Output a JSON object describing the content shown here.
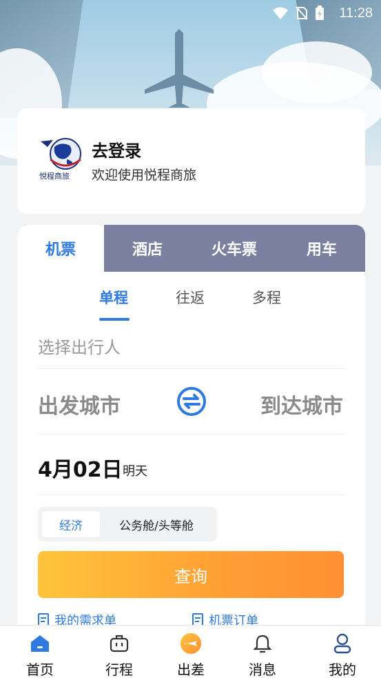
{
  "status_bar": {
    "time": "11:28"
  },
  "login": {
    "title": "去登录",
    "subtitle": "欢迎使用悦程商旅",
    "logo_icon": "globe-logo-icon"
  },
  "service_tabs": [
    {
      "label": "机票",
      "active": true
    },
    {
      "label": "酒店",
      "active": false
    },
    {
      "label": "火车票",
      "active": false
    },
    {
      "label": "用车",
      "active": false
    }
  ],
  "trip_types": [
    {
      "label": "单程",
      "active": true
    },
    {
      "label": "往返",
      "active": false
    },
    {
      "label": "多程",
      "active": false
    }
  ],
  "traveler": {
    "placeholder": "选择出行人"
  },
  "cities": {
    "from": "出发城市",
    "to": "到达城市",
    "swap_icon": "swap-icon"
  },
  "date": {
    "main": "4月02日",
    "sub": "明天"
  },
  "cabin": {
    "options": [
      "经济",
      "公务舱/头等舱"
    ],
    "selected": "经济"
  },
  "search": {
    "label": "查询"
  },
  "quick_links": [
    {
      "label": "我的需求单",
      "icon": "document-icon"
    },
    {
      "label": "机票订单",
      "icon": "document-icon"
    }
  ],
  "bottom_nav": [
    {
      "label": "首页",
      "icon": "home-icon",
      "active": true
    },
    {
      "label": "行程",
      "icon": "briefcase-icon",
      "active": false
    },
    {
      "label": "出差",
      "icon": "plane-badge-icon",
      "active": false
    },
    {
      "label": "消息",
      "icon": "bell-icon",
      "active": false
    },
    {
      "label": "我的",
      "icon": "user-icon",
      "active": false
    }
  ],
  "colors": {
    "accent": "#2f7ae0",
    "tab_bar": "#7b80a0",
    "button_start": "#ffc43b",
    "button_end": "#ff8f33"
  }
}
